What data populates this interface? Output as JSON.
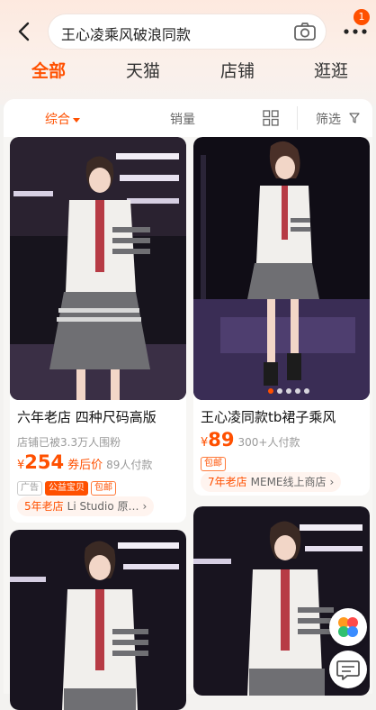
{
  "search": {
    "query": "王心凌乘风破浪同款"
  },
  "header": {
    "badge_count": "1"
  },
  "tabs": [
    {
      "label": "全部"
    },
    {
      "label": "天猫"
    },
    {
      "label": "店铺"
    },
    {
      "label": "逛逛"
    }
  ],
  "sortbar": {
    "comprehensive": "综合",
    "sales": "销量",
    "filter": "筛选"
  },
  "products": [
    {
      "title": "六年老店 四种尺码高版",
      "fans": "店铺已被3.3万人围粉",
      "currency": "¥",
      "price": "254",
      "coupon": "券后价",
      "sold": "89人付款",
      "tags": [
        "广告",
        "公益宝贝",
        "包邮"
      ],
      "store_years": "5年老店",
      "store_name": "Li Studio 原…"
    },
    {
      "title": "王心凌同款tb裙子乘风",
      "currency": "¥",
      "price": "89",
      "sold": "300+人付款",
      "tags": [
        "包邮"
      ],
      "store_years": "7年老店",
      "store_name": "MEME线上商店"
    }
  ],
  "icons": {
    "back": "chevron-left-icon",
    "camera": "camera-icon",
    "more": "more-dots-icon",
    "grid": "grid-view-icon",
    "filter": "filter-icon"
  },
  "colors": {
    "accent": "#ff5000",
    "outfit_white": "#f1efec",
    "skirt_grey": "#6f6f73"
  }
}
